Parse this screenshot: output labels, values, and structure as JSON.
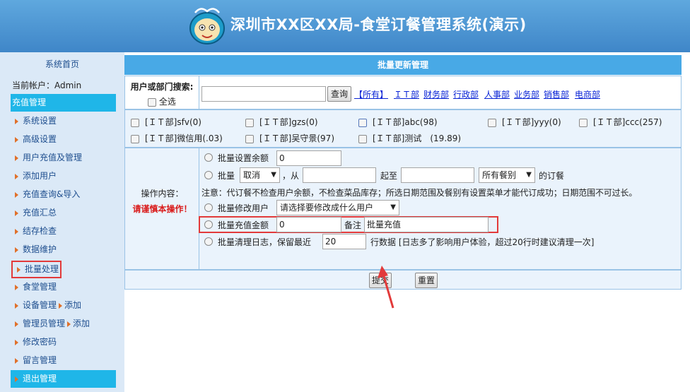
{
  "header": {
    "title": "深圳市XX区XX局-食堂订餐管理系统(演示)"
  },
  "sidebar": {
    "home": "系统首页",
    "account": "当前帐户：Admin",
    "section": "充值管理",
    "items": [
      {
        "label": "系统设置"
      },
      {
        "label": "高级设置"
      },
      {
        "label": "用户充值及管理"
      },
      {
        "label": "添加用户"
      },
      {
        "label": "充值查询&导入"
      },
      {
        "label": "充值汇总"
      },
      {
        "label": "结存检查"
      },
      {
        "label": "数据维护"
      },
      {
        "label": "批量处理"
      },
      {
        "label": "食堂管理"
      },
      {
        "label": "设备管理",
        "sub": "添加"
      },
      {
        "label": "管理员管理",
        "sub": "添加"
      },
      {
        "label": "修改密码"
      },
      {
        "label": "留言管理"
      },
      {
        "label": "退出管理"
      }
    ]
  },
  "panel": {
    "title": "批量更新管理",
    "search": {
      "label": "用户或部门搜索:",
      "select_all": "全选",
      "input_value": "",
      "query_button": "查询",
      "links": [
        "【所有】",
        "ＩＴ部",
        "财务部",
        "行政部",
        "人事部",
        "业务部",
        "销售部",
        "电商部"
      ]
    },
    "users": [
      "[ＩＴ部]sfv(0)",
      "[ＩＴ部]gzs(0)",
      "[ＩＴ部]abc(98)",
      "[ＩＴ部]yyy(0)",
      "[ＩＴ部]ccc(257)",
      "[ＩＴ部]微信用(.03)",
      "[ＩＴ部]吴守景(97)",
      "[ＩＴ部]测试　(19.89)"
    ],
    "ops": {
      "label": "操作内容：",
      "warning": "请谨慎本操作！",
      "set_balance_label": "批量设置余额",
      "set_balance_value": "0",
      "batch_label": "批量",
      "batch_action": "取消",
      "from_label": "，从",
      "from_value": "",
      "to_label": "起至",
      "to_value": "",
      "meal_type": "所有餐别",
      "orders_label": "的订餐",
      "note": "注意：代订餐不检查用户余额，不检查菜品库存；所选日期范围及餐别有设置菜单才能代订成功；日期范围不可过长。",
      "modify_user_label": "批量修改用户",
      "modify_user_select": "请选择要修改成什么用户",
      "recharge_label": "批量充值金额",
      "recharge_value": "0",
      "remark_label": "备注",
      "remark_value": "批量充值",
      "clean_log_label": "批量清理日志，保留最近",
      "clean_log_value": "20",
      "clean_log_suffix": "行数据 [日志多了影响用户体验，超过20行时建议清理一次]"
    },
    "submit_button": "提交",
    "reset_button": "重置"
  },
  "colors": {
    "header": "#3f86c8",
    "accent": "#1fb6e8",
    "highlight": "#e23a3a"
  }
}
